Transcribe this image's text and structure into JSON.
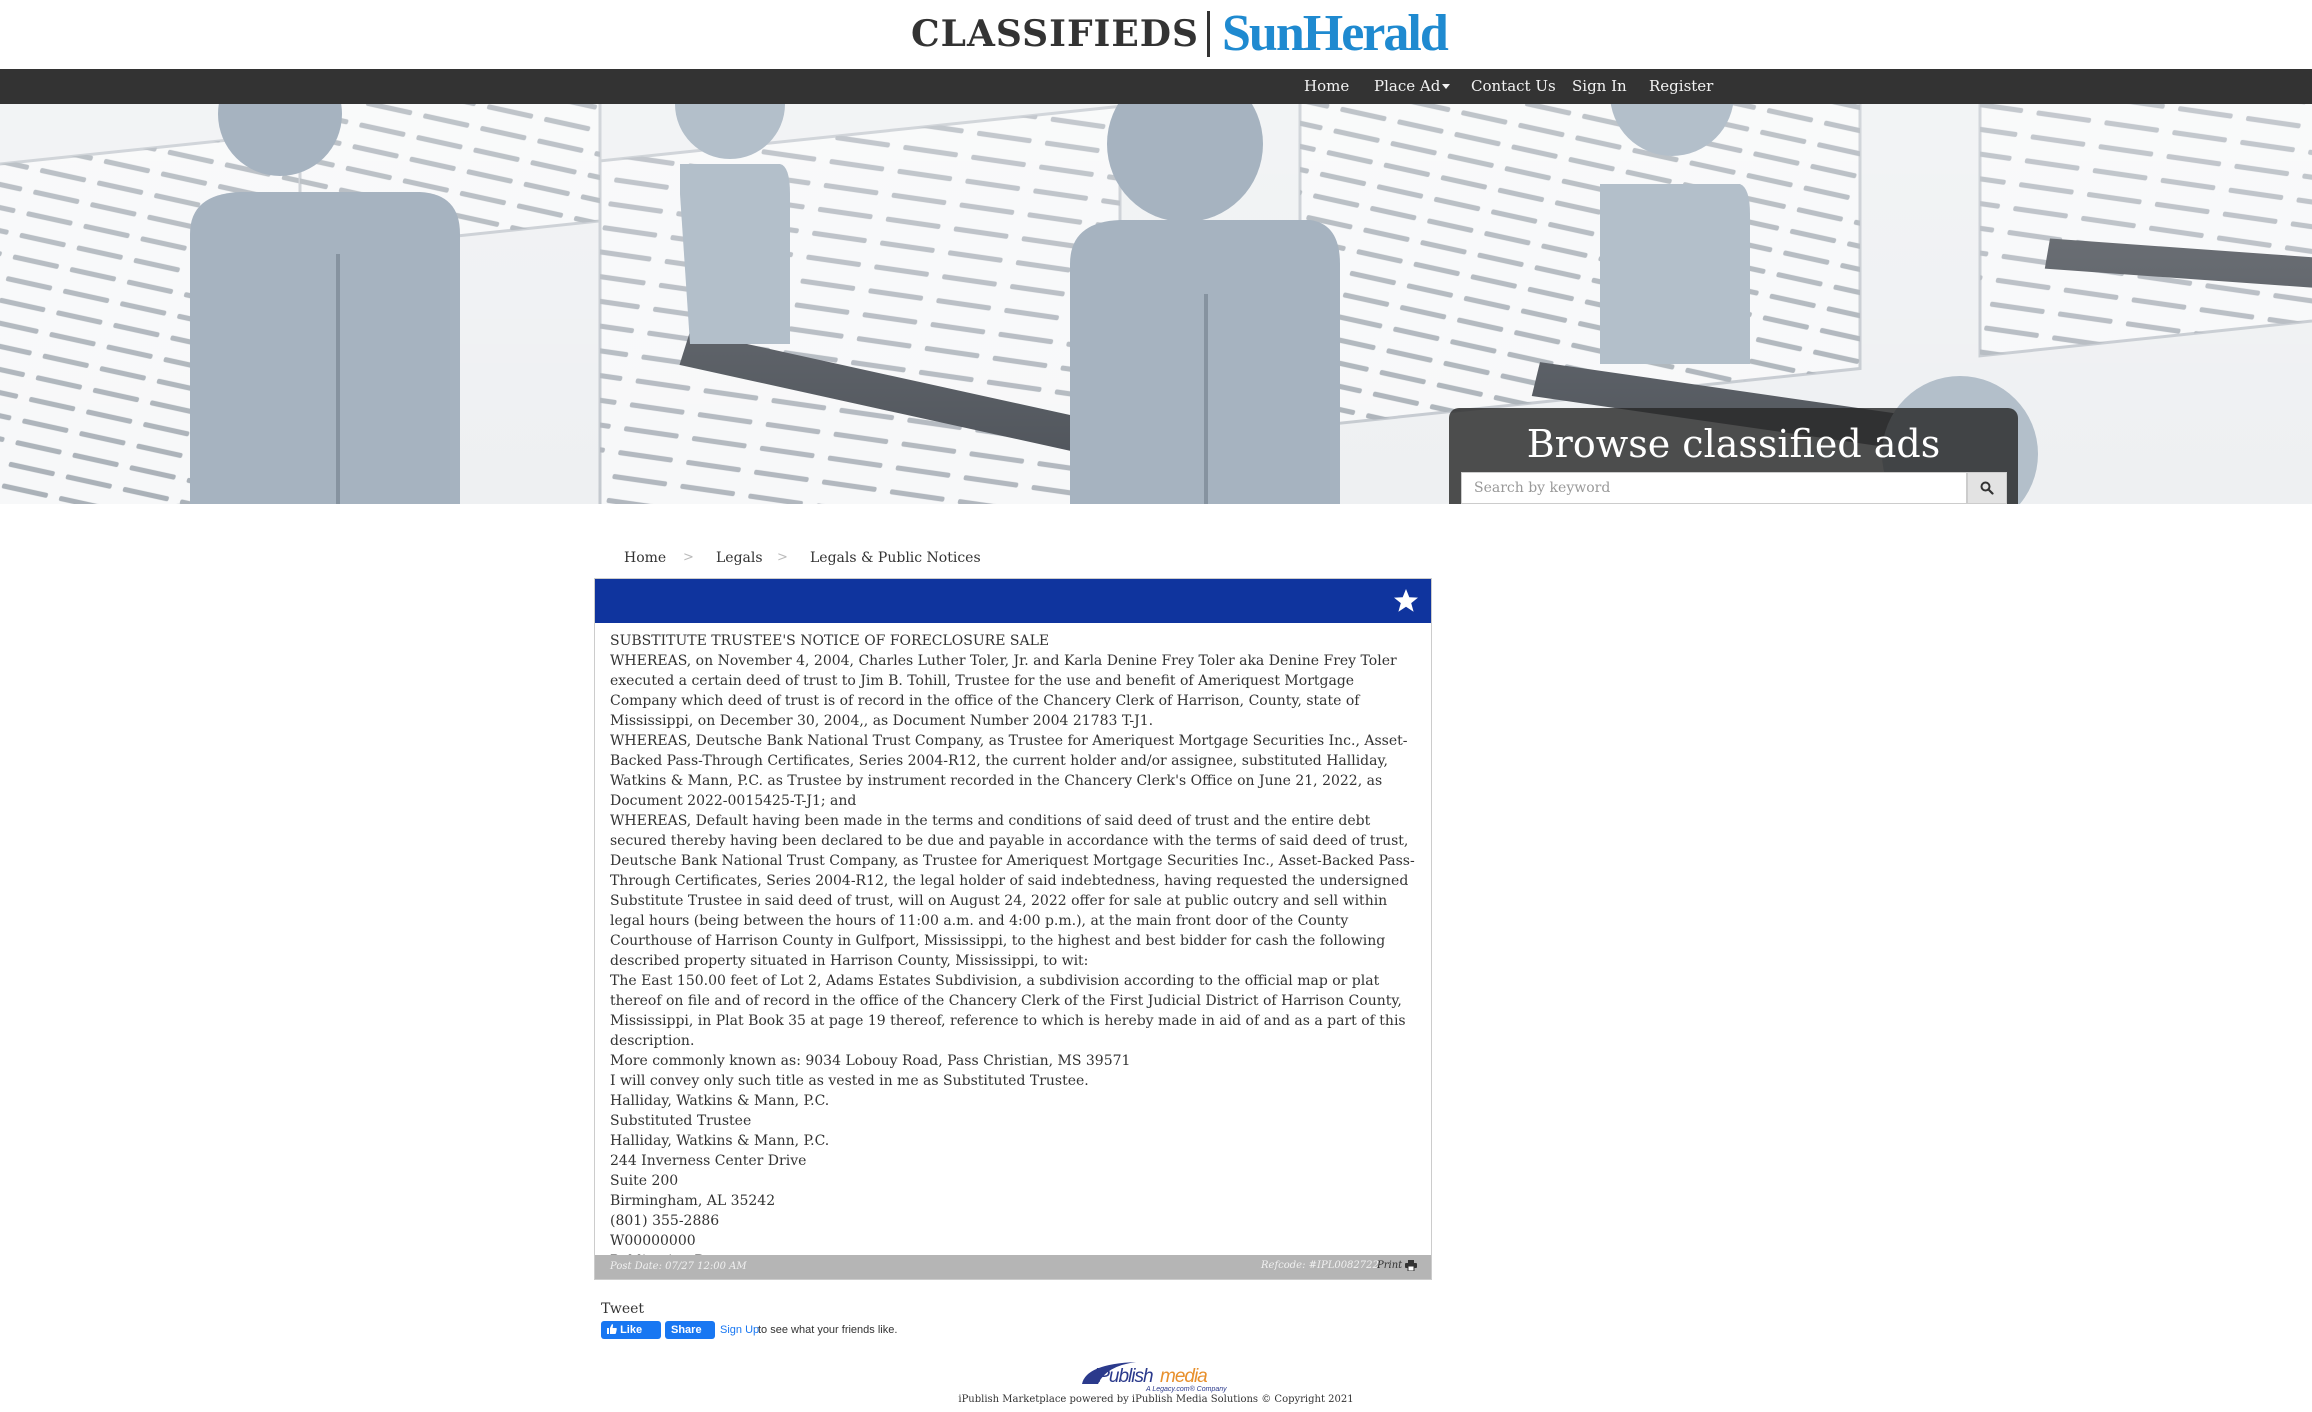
{
  "logo": {
    "classifieds": "CLASSIFIEDS",
    "brand": "SunHerald"
  },
  "nav": {
    "home": "Home",
    "place_ad": "Place Ad",
    "contact": "Contact Us",
    "sign_in": "Sign In",
    "register": "Register"
  },
  "hero": {
    "title": "Browse classified ads",
    "search_placeholder": "Search by keyword",
    "search_icon": "search-icon"
  },
  "breadcrumb": [
    "Home",
    "Legals",
    "Legals & Public Notices"
  ],
  "breadcrumb_separator": ">",
  "ad": {
    "favorite_icon": "star-icon",
    "lines": [
      "SUBSTITUTE TRUSTEE'S NOTICE OF FORECLOSURE SALE",
      "WHEREAS, on November 4, 2004, Charles Luther Toler, Jr. and Karla Denine Frey Toler aka Denine Frey Toler executed a certain deed of trust to Jim B. Tohill, Trustee for the use and benefit of Ameriquest Mortgage Company which deed of trust is of record in the office of the Chancery Clerk of Harrison, County, state of Mississippi, on December 30, 2004,, as Document Number 2004 21783 T-J1.",
      "WHEREAS, Deutsche Bank National Trust Company, as Trustee for Ameriquest Mortgage Securities Inc., Asset-Backed Pass-Through Certificates, Series 2004-R12, the current holder and/or assignee, substituted Halliday, Watkins & Mann, P.C. as Trustee by instrument recorded in the Chancery Clerk's Office on June 21, 2022, as Document 2022-0015425-T-J1; and",
      "WHEREAS, Default having been made in the terms and conditions of said deed of trust and the entire debt secured thereby having been declared to be due and payable in accordance with the terms of said deed of trust, Deutsche Bank National Trust Company, as Trustee for Ameriquest Mortgage Securities Inc., Asset-Backed Pass- Through Certificates, Series 2004-R12, the legal holder of said indebtedness, having requested the undersigned Substitute Trustee in said deed of trust, will on August 24, 2022 offer for sale at public outcry and sell within legal hours (being between the hours of 11:00 a.m. and 4:00 p.m.), at the main front door of the County Courthouse of Harrison County in Gulfport, Mississippi, to the highest and best bidder for cash the following described property situated in Harrison County, Mississippi, to wit:",
      "The East 150.00 feet of Lot 2, Adams Estates Subdivision, a subdivision according to the official map or plat thereof on file and of record in the office of the Chancery Clerk of the First Judicial District of Harrison County, Mississippi, in Plat Book 35 at page 19 thereof, reference to which is hereby made in aid of and as a part of this description.",
      "More commonly known as: 9034 Lobouy Road, Pass Christian, MS 39571",
      "I will convey only such title as vested in me as Substituted Trustee.",
      "Halliday, Watkins & Mann, P.C.",
      "Substituted Trustee",
      "Halliday, Watkins & Mann, P.C.",
      "244 Inverness Center Drive",
      "Suite 200",
      "Birmingham, AL 35242",
      "(801) 355-2886",
      "W00000000",
      "Publication Dates"
    ],
    "post_date": "Post Date: 07/27 12:00 AM",
    "refcode": "Refcode: #IPL0082722",
    "print": "Print",
    "print_icon": "printer-icon"
  },
  "social": {
    "tweet": "Tweet",
    "like": "Like",
    "share": "Share",
    "sign_up": "Sign Up",
    "friends_text": "to see what your friends like."
  },
  "footer": {
    "logo_main": "iPublish",
    "logo_accent": "media",
    "logo_sub": "A Legacy.com® Company",
    "copyright": "iPublish Marketplace powered by iPublish Media Solutions © Copyright 2021"
  },
  "colors": {
    "navbar": "#333333",
    "ad_header": "#0f349e",
    "brand": "#1f8ad0",
    "footer_bar": "#b5b5b5"
  }
}
